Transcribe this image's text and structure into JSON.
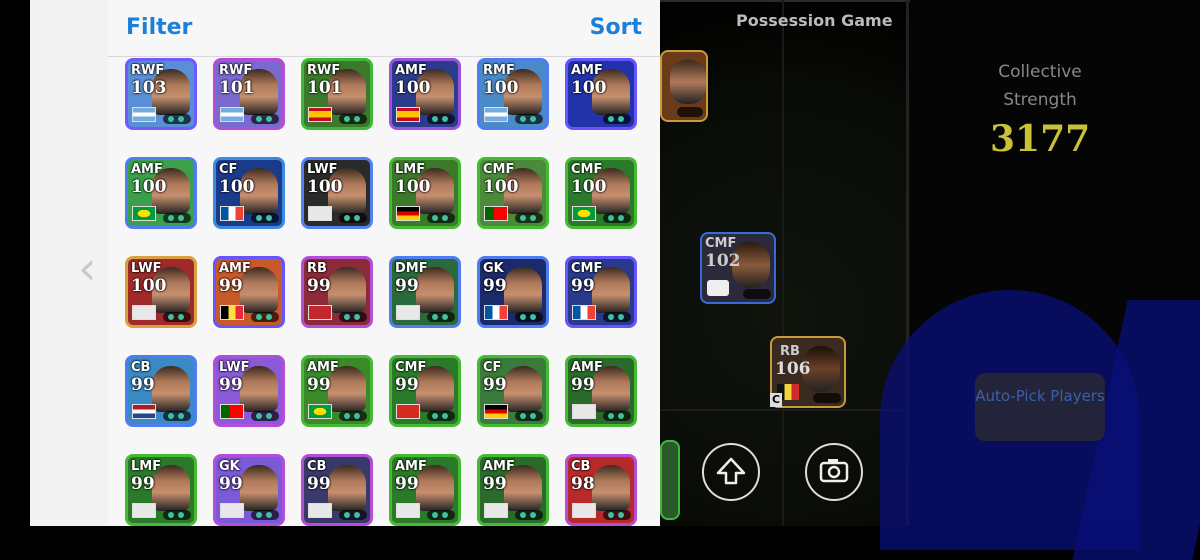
{
  "panel": {
    "filter_label": "Filter",
    "sort_label": "Sort"
  },
  "cards": [
    {
      "pos": "RWF",
      "rating": "103",
      "border": "#6a5cff",
      "bg": "#5a8fd6",
      "flag": "argentina"
    },
    {
      "pos": "RWF",
      "rating": "101",
      "border": "#b44dd8",
      "bg": "#7a6ad0",
      "flag": "argentina"
    },
    {
      "pos": "RWF",
      "rating": "101",
      "border": "#3fb83a",
      "bg": "#3a7a2a",
      "flag": "spain"
    },
    {
      "pos": "AMF",
      "rating": "100",
      "border": "#9a52e0",
      "bg": "#2a3c8a",
      "flag": "spain"
    },
    {
      "pos": "RMF",
      "rating": "100",
      "border": "#4f7cf0",
      "bg": "#4a8ac8",
      "flag": "argentina"
    },
    {
      "pos": "AMF",
      "rating": "100",
      "border": "#6655ff",
      "bg": "#2233aa",
      "flag": "none"
    },
    {
      "pos": "AMF",
      "rating": "100",
      "border": "#4f7cf0",
      "bg": "#3aa04a",
      "flag": "brazil"
    },
    {
      "pos": "CF",
      "rating": "100",
      "border": "#3a8ae0",
      "bg": "#1a3a8a",
      "flag": "france"
    },
    {
      "pos": "LWF",
      "rating": "100",
      "border": "#5580f0",
      "bg": "#2a2a2a",
      "flag": "club"
    },
    {
      "pos": "LMF",
      "rating": "100",
      "border": "#44bb33",
      "bg": "#3a7a2a",
      "flag": "germany"
    },
    {
      "pos": "CMF",
      "rating": "100",
      "border": "#44bb33",
      "bg": "#4a8a3a",
      "flag": "portugal"
    },
    {
      "pos": "CMF",
      "rating": "100",
      "border": "#44bb33",
      "bg": "#2a7a2a",
      "flag": "brazil"
    },
    {
      "pos": "LWF",
      "rating": "100",
      "border": "#d8a040",
      "bg": "#a02a2a",
      "flag": "club"
    },
    {
      "pos": "AMF",
      "rating": "99",
      "border": "#6655ff",
      "bg": "#c85a2a",
      "flag": "belgium"
    },
    {
      "pos": "RB",
      "rating": "99",
      "border": "#b44dd8",
      "bg": "#8a2a3a",
      "flag": "morocco"
    },
    {
      "pos": "DMF",
      "rating": "99",
      "border": "#4f7cf0",
      "bg": "#2a6a3a",
      "flag": "club"
    },
    {
      "pos": "GK",
      "rating": "99",
      "border": "#4f7cf0",
      "bg": "#1a2a6a",
      "flag": "france"
    },
    {
      "pos": "CMF",
      "rating": "99",
      "border": "#6655ff",
      "bg": "#2a3a8a",
      "flag": "france"
    },
    {
      "pos": "CB",
      "rating": "99",
      "border": "#4f7cf0",
      "bg": "#3a8ac8",
      "flag": "netherlands"
    },
    {
      "pos": "LWF",
      "rating": "99",
      "border": "#b44dd8",
      "bg": "#8a5ad8",
      "flag": "portugal"
    },
    {
      "pos": "AMF",
      "rating": "99",
      "border": "#44bb33",
      "bg": "#3a8a2a",
      "flag": "brazil"
    },
    {
      "pos": "CMF",
      "rating": "99",
      "border": "#44bb33",
      "bg": "#2a7a2a",
      "flag": "switzerland"
    },
    {
      "pos": "CF",
      "rating": "99",
      "border": "#44bb33",
      "bg": "#3a7a3a",
      "flag": "germany"
    },
    {
      "pos": "AMF",
      "rating": "99",
      "border": "#44bb33",
      "bg": "#2a6a2a",
      "flag": "club"
    },
    {
      "pos": "LMF",
      "rating": "99",
      "border": "#44bb33",
      "bg": "#2a7a2a",
      "flag": "club"
    },
    {
      "pos": "GK",
      "rating": "99",
      "border": "#b44dd8",
      "bg": "#7a5ad8",
      "flag": "club"
    },
    {
      "pos": "CB",
      "rating": "99",
      "border": "#b44dd8",
      "bg": "#3a3a6a",
      "flag": "club"
    },
    {
      "pos": "AMF",
      "rating": "99",
      "border": "#44bb33",
      "bg": "#2a7a2a",
      "flag": "club"
    },
    {
      "pos": "AMF",
      "rating": "99",
      "border": "#44bb33",
      "bg": "#2a6a2a",
      "flag": "club"
    },
    {
      "pos": "CB",
      "rating": "98",
      "border": "#b44dd8",
      "bg": "#b82a2a",
      "flag": "club"
    }
  ],
  "field": {
    "mode_title": "Possession Game",
    "cards": [
      {
        "pos": "CMF",
        "rating": "102"
      },
      {
        "pos": "RB",
        "rating": "106"
      }
    ]
  },
  "sidebar": {
    "collective_label": "Collective Strength",
    "collective_value": "3177",
    "autopick_label": "Auto-Pick Players"
  },
  "colors": {
    "accent_blue": "#1e7fd8",
    "strength_yellow": "#c9c236"
  }
}
